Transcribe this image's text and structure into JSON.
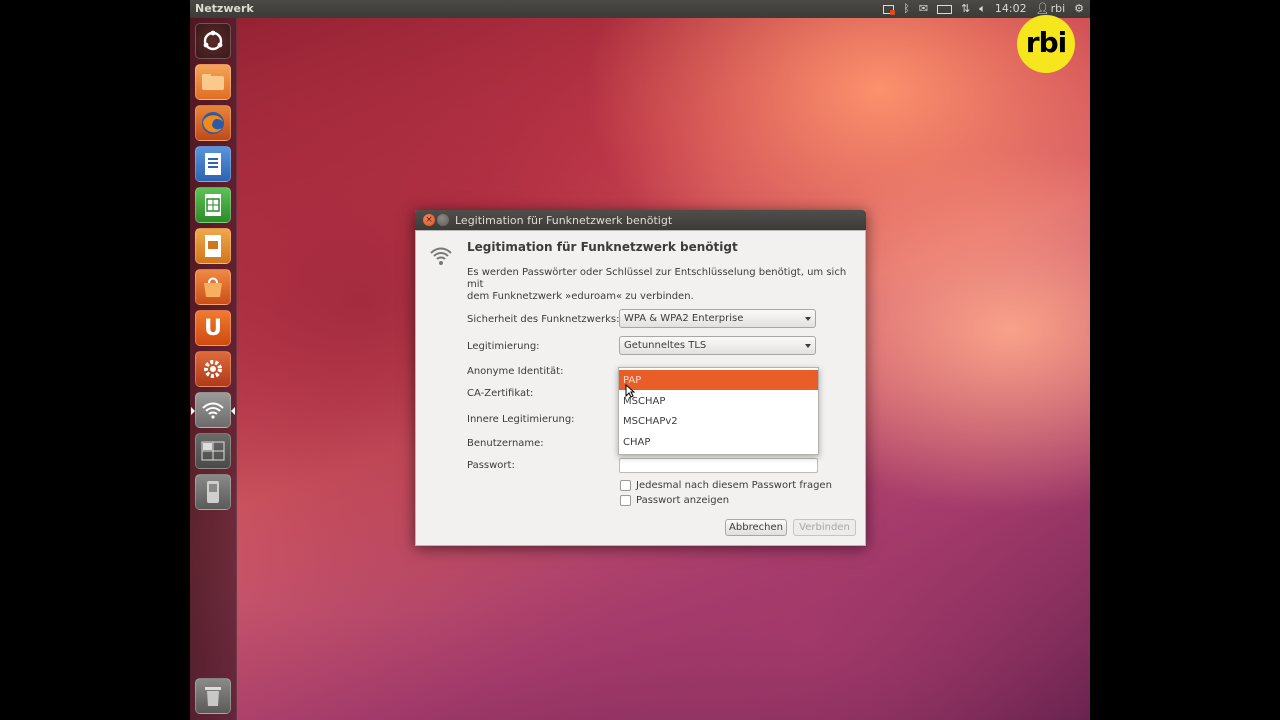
{
  "top_panel": {
    "app_title": "Netzwerk",
    "clock": "14:02",
    "user": "rbi",
    "icons": [
      "record-icon",
      "bluetooth-icon",
      "mail-icon",
      "battery-icon",
      "network-updown-icon",
      "volume-icon",
      "user-icon",
      "gear-icon"
    ]
  },
  "launcher": {
    "items": [
      {
        "name": "dash-home",
        "color": "#d9542b"
      },
      {
        "name": "home-folder",
        "color": "#e98b3a"
      },
      {
        "name": "firefox",
        "color": "#d35c1c"
      },
      {
        "name": "libreoffice-writer",
        "color": "#3c78c8"
      },
      {
        "name": "libreoffice-calc",
        "color": "#3fa43c"
      },
      {
        "name": "libreoffice-impress",
        "color": "#e08a2a"
      },
      {
        "name": "software-center",
        "color": "#e06a2a"
      },
      {
        "name": "ubuntu-one",
        "color": "#e05a1a"
      },
      {
        "name": "system-settings",
        "color": "#c94a2a"
      },
      {
        "name": "network-manager",
        "color": "#8a8a8a"
      },
      {
        "name": "workspace-switcher",
        "color": "#6a6a6a"
      },
      {
        "name": "removable-drive",
        "color": "#7a7a7a"
      },
      {
        "name": "trash",
        "color": "#7a7a7a"
      }
    ]
  },
  "dialog": {
    "window_title": "Legitimation für Funknetzwerk benötigt",
    "heading": "Legitimation für Funknetzwerk benötigt",
    "description_line1": "Es werden Passwörter oder Schlüssel zur Entschlüsselung benötigt, um sich mit",
    "description_line2": "dem Funknetzwerk »eduroam« zu verbinden.",
    "fields": {
      "security_label": "Sicherheit des Funknetzwerks:",
      "security_value": "WPA & WPA2 Enterprise",
      "auth_label": "Legitimierung:",
      "auth_value": "Getunneltes TLS",
      "anon_label": "Anonyme Identität:",
      "ca_label": "CA-Zertifikat:",
      "inner_label": "Innere Legitimierung:",
      "user_label": "Benutzername:",
      "password_label": "Passwort:"
    },
    "checkboxes": {
      "ask_every_time": "Jedesmal nach diesem Passwort fragen",
      "show_password": "Passwort anzeigen"
    },
    "buttons": {
      "cancel": "Abbrechen",
      "connect": "Verbinden"
    }
  },
  "dropdown": {
    "options": [
      "PAP",
      "MSCHAP",
      "MSCHAPv2",
      "CHAP"
    ],
    "selected": "PAP"
  },
  "logo": {
    "text": "rbi"
  },
  "colors": {
    "accent": "#e95e26",
    "panel": "#3c3b37",
    "dialog_bg": "#f2f1f0",
    "logo_yellow": "#f5e61e"
  }
}
